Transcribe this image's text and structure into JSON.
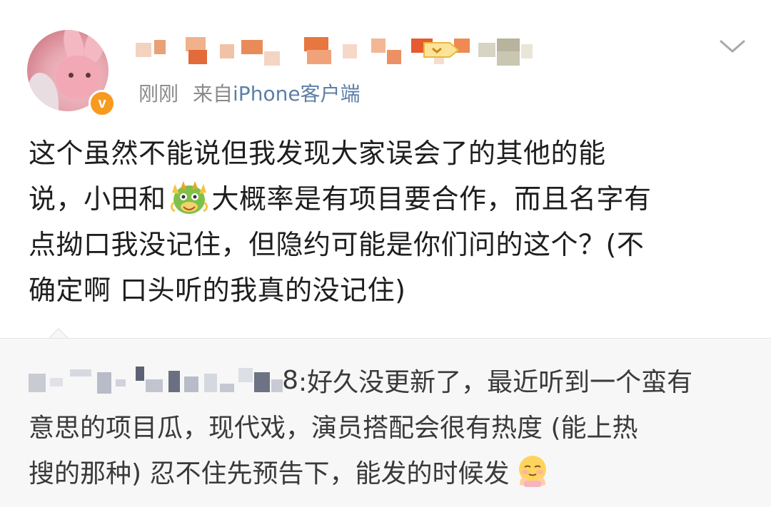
{
  "post": {
    "author": {
      "display_name": "",
      "verified": true
    },
    "time": "刚刚",
    "source_prefix": "来自",
    "source_client": "iPhone客户端",
    "body_lines": [
      "这个虽然不能说但我发现大家误会了的其他的能",
      "说，小田和",
      "大概率是有项目要合作，而且名字有",
      "点拗口我没记住，但隐约可能是你们问的这个？(不",
      "确定啊 口头听的我真的没记住)"
    ]
  },
  "repost": {
    "author_suffix": "8",
    "separator": ":",
    "text_line1": "好久没更新了，最近听到一个蛮有",
    "text_line2": "意思的项目瓜，现代戏，演员搭配会很有热度 (能上热",
    "text_line3": "搜的那种) 忍不住先预告下，能发的时候发"
  },
  "icons": {
    "verified_badge": "v-verified-icon",
    "more": "chevron-down-icon",
    "dragon": "dragon-emoji",
    "shy": "shy-emoji"
  },
  "colors": {
    "verified": "#f79a1f",
    "client_link": "#5b7fa8",
    "repost_bg": "#f7f7f7"
  }
}
